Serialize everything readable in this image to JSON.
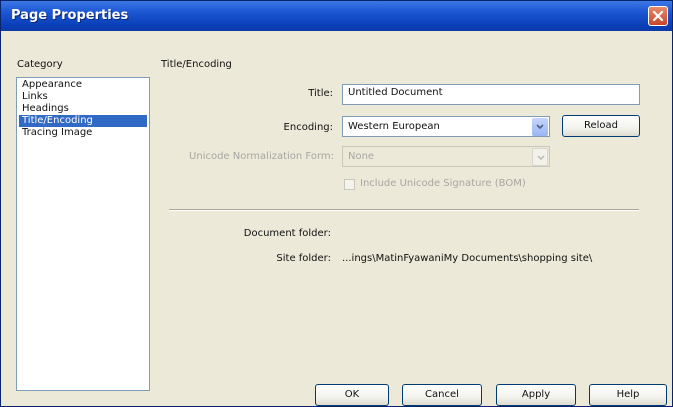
{
  "window": {
    "title": "Page Properties"
  },
  "category": {
    "heading": "Category",
    "items": [
      {
        "label": "Appearance"
      },
      {
        "label": "Links"
      },
      {
        "label": "Headings"
      },
      {
        "label": "Title/Encoding",
        "selected": true
      },
      {
        "label": "Tracing Image"
      }
    ]
  },
  "panel": {
    "heading": "Title/Encoding",
    "title_label": "Title:",
    "title_value": "Untitled Document",
    "encoding_label": "Encoding:",
    "encoding_value": "Western European",
    "reload_label": "Reload",
    "unicode_form_label": "Unicode Normalization Form:",
    "unicode_form_value": "None",
    "bom_label": "Include Unicode Signature (BOM)",
    "document_folder_label": "Document folder:",
    "document_folder_value": "",
    "site_folder_label": "Site folder:",
    "site_folder_value": "...ings\\MatinFyawaniMy Documents\\shopping site\\"
  },
  "buttons": {
    "ok": "OK",
    "cancel": "Cancel",
    "apply": "Apply",
    "help": "Help"
  },
  "colors": {
    "title_bar": "#0a3fb8",
    "selection": "#316ac5",
    "dialog_bg": "#ece9d8",
    "close_button": "#c8452a"
  }
}
